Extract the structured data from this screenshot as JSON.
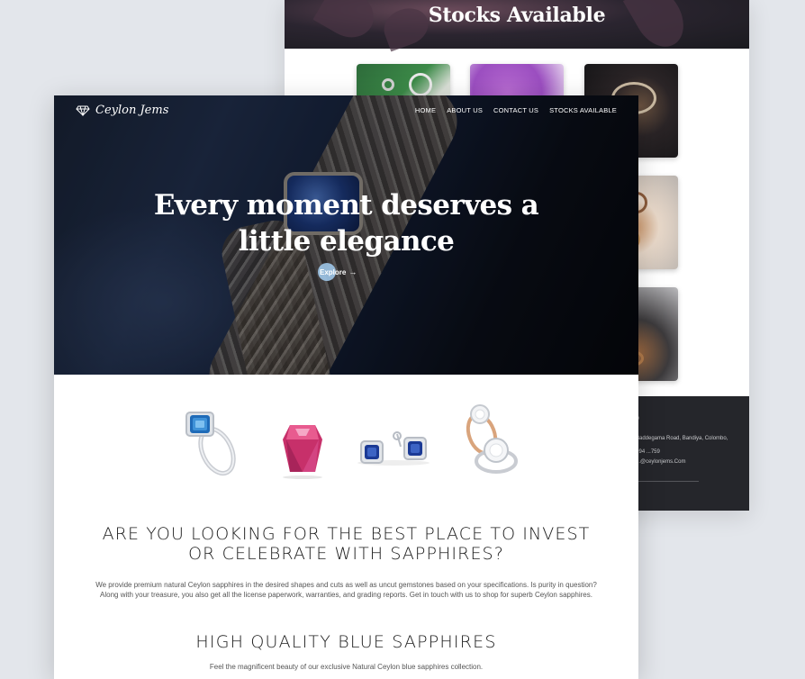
{
  "back_page": {
    "title": "Stocks Available",
    "footer_lines": [
      "Baddegama Road, Bandiya, Colombo,",
      "+94 ...759",
      "...@ceylonjems.Com"
    ]
  },
  "front_page": {
    "logo": {
      "text": "Ceylon Jems",
      "icon": "diamond-icon"
    },
    "nav": [
      "HOME",
      "ABOUT US",
      "CONTACT US",
      "STOCKS AVAILABLE"
    ],
    "hero": {
      "headline_line1": "Every moment deserves a",
      "headline_line2": "little elegance",
      "cta_label": "Explore",
      "cta_arrow": "→"
    },
    "products": [
      "blue-sapphire-ring",
      "pink-sapphire-gem",
      "blue-sapphire-earrings",
      "diamond-engagement-rings"
    ],
    "section1": {
      "heading_line1": "ARE YOU LOOKING FOR THE BEST PLACE TO INVEST",
      "heading_line2": "OR CELEBRATE WITH SAPPHIRES?",
      "body_line1": "We provide premium natural Ceylon sapphires in the desired shapes and cuts as well as uncut gemstones based on your specifications. Is purity in question?",
      "body_line2": "Along with your treasure, you also get all the license paperwork, warranties, and grading reports. Get in touch with us to shop for superb Ceylon sapphires."
    },
    "section2": {
      "heading": "HIGH QUALITY BLUE SAPPHIRES",
      "body": "Feel the magnificent beauty of our exclusive Natural Ceylon blue sapphires collection."
    }
  },
  "colors": {
    "hero_dark": "#0b0f19",
    "cta_circle": "#9fc7e9",
    "footer_dark": "#25262b",
    "sapphire_blue": "#1e3c82",
    "pink_sapphire": "#d4487a"
  }
}
